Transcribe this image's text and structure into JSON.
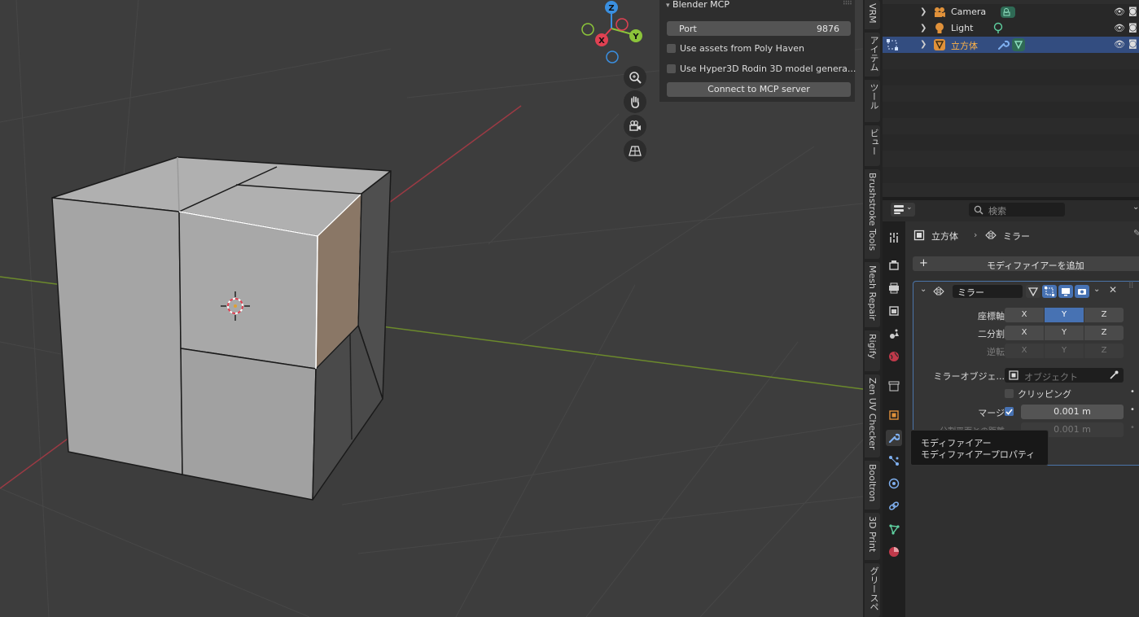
{
  "viewport": {
    "gizmo": {
      "z": "Z",
      "y": "Y",
      "x": "X"
    },
    "nav_icons": [
      "zoom-icon",
      "hand-pan-icon",
      "camera-view-icon",
      "grid-ortho-icon"
    ]
  },
  "npanel": {
    "title": "Blender MCP",
    "port_label": "Port",
    "port_value": "9876",
    "poly_haven": "Use assets from Poly Haven",
    "hyper3d": "Use Hyper3D Rodin 3D model genera...",
    "connect": "Connect to MCP server"
  },
  "sidebar_tabs": [
    "VRM",
    "アイテム",
    "ツール",
    "ビュー",
    "Brushstroke Tools",
    "Mesh Repair",
    "Rigify",
    "Zen UV Checker",
    "Booltron",
    "3D Print",
    "グリースペ"
  ],
  "outliner": {
    "items": [
      {
        "name": "Camera",
        "icon": "camera-icon"
      },
      {
        "name": "Light",
        "icon": "light-icon"
      },
      {
        "name": "立方体",
        "icon": "mesh-icon",
        "selected": true
      }
    ]
  },
  "properties": {
    "search_placeholder": "検索",
    "breadcrumb_object": "立方体",
    "breadcrumb_modifier": "ミラー",
    "add_modifier": "モディファイアーを追加",
    "modifier_name": "ミラー",
    "axis_label": "座標軸",
    "bisect_label": "二分割",
    "flip_label": "逆転",
    "axes": [
      "X",
      "Y",
      "Z"
    ],
    "mirror_object_label": "ミラーオブジェ...",
    "object_placeholder": "オブジェクト",
    "clipping": "クリッピング",
    "merge_label": "マージ",
    "merge_value": "0.001 m",
    "bisect_distance_label": "分割平面との距離",
    "bisect_distance_value": "0.001 m"
  },
  "tooltip": {
    "line1": "モディファイアー",
    "line2": "モディファイアープロパティ"
  },
  "colors": {
    "selection": "#334d80",
    "accent": "#4772b3",
    "x_axis": "#e04152",
    "y_axis": "#8bc43a",
    "z_axis": "#3a8fe0"
  }
}
